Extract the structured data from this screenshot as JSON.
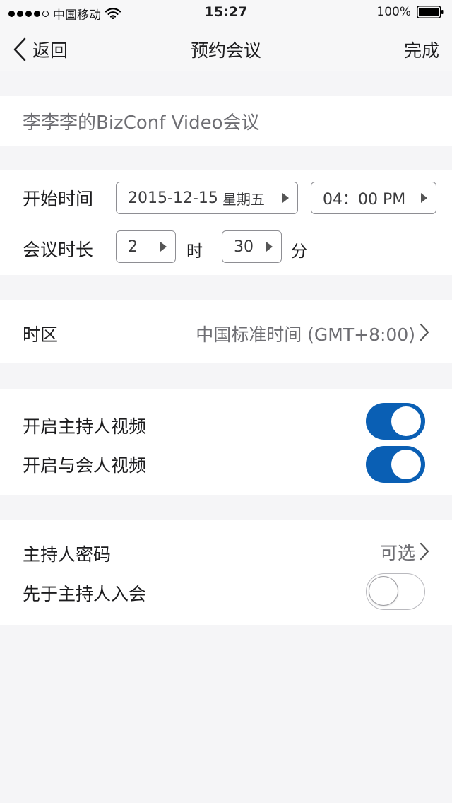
{
  "status_bar": {
    "carrier": "中国移动",
    "time": "15:27",
    "battery": "100%"
  },
  "nav": {
    "back_label": "返回",
    "title": "预约会议",
    "done_label": "完成"
  },
  "meeting": {
    "name_value": "李李李的BizConf Video会议"
  },
  "schedule": {
    "start_label": "开始时间",
    "date_value": "2015-12-15",
    "weekday_value": "星期五",
    "time_value": "04：00 PM",
    "duration_label": "会议时长",
    "hours_value": "2",
    "hours_unit": "时",
    "minutes_value": "30",
    "minutes_unit": "分"
  },
  "timezone": {
    "label": "时区",
    "value": "中国标准时间 (GMT+8:00)"
  },
  "video": {
    "host_video_label": "开启主持人视频",
    "host_video_on": true,
    "participant_video_label": "开启与会人视频",
    "participant_video_on": true
  },
  "security": {
    "host_password_label": "主持人密码",
    "host_password_value": "可选",
    "join_before_host_label": "先于主持人入会",
    "join_before_host_on": false
  },
  "colors": {
    "accent": "#0a5fb4",
    "background": "#f5f5f7"
  }
}
